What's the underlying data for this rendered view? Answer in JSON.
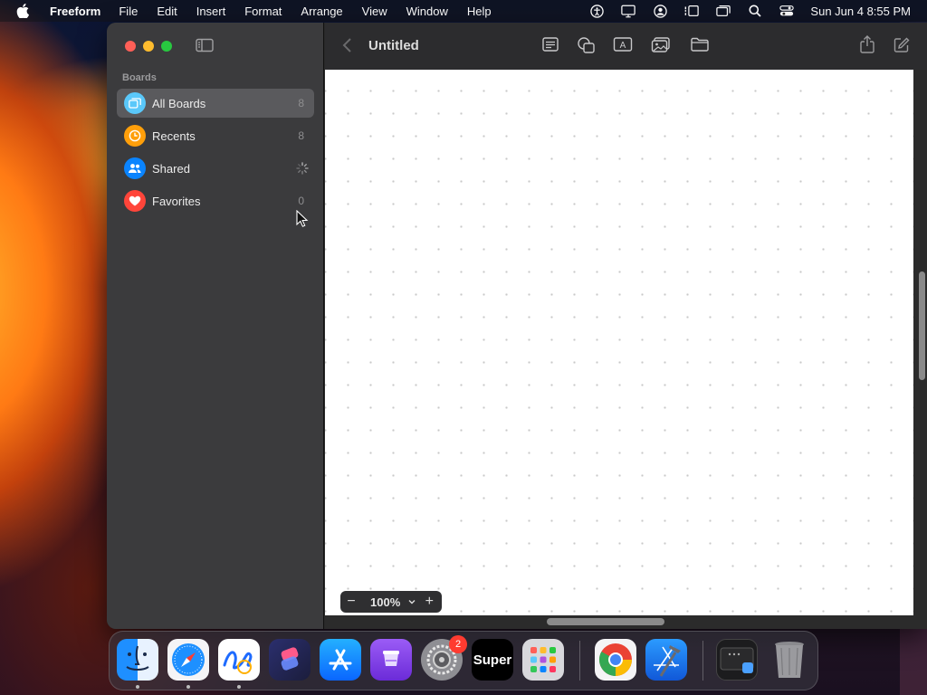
{
  "menubar": {
    "apple_icon": "apple-logo-icon",
    "app_name": "Freeform",
    "menus": [
      "File",
      "Edit",
      "Insert",
      "Format",
      "Arrange",
      "View",
      "Window",
      "Help"
    ],
    "status_icons": [
      "accessibility-icon",
      "display-icon",
      "user-icon",
      "stage-manager-icon",
      "window-icon",
      "search-icon",
      "control-center-icon"
    ],
    "clock": "Sun Jun 4  8:55 PM"
  },
  "sidebar": {
    "section_title": "Boards",
    "items": [
      {
        "label": "All Boards",
        "count": "8",
        "icon": "all-boards-icon",
        "color": "#5ac8fa"
      },
      {
        "label": "Recents",
        "count": "8",
        "icon": "clock-icon",
        "color": "#ff9f0a"
      },
      {
        "label": "Shared",
        "count": "",
        "icon": "people-icon",
        "color": "#0a84ff"
      },
      {
        "label": "Favorites",
        "count": "0",
        "icon": "heart-icon",
        "color": "#ff453a"
      }
    ]
  },
  "toolbar": {
    "title": "Untitled",
    "buttons": [
      "sticky-note-icon",
      "shapes-icon",
      "text-box-icon",
      "media-icon",
      "files-icon",
      "share-icon",
      "new-board-icon"
    ]
  },
  "zoom": {
    "minus": "−",
    "value": "100%",
    "plus": "+"
  },
  "dock": {
    "apps": [
      "Finder",
      "Safari",
      "Freeform",
      "Shortcuts",
      "App Store",
      "Podcasts Mini",
      "System Settings",
      "Super",
      "Launchpad",
      "Chrome",
      "Xcode",
      "Terminal",
      "Trash"
    ],
    "settings_badge": "2",
    "super_label": "Super"
  }
}
